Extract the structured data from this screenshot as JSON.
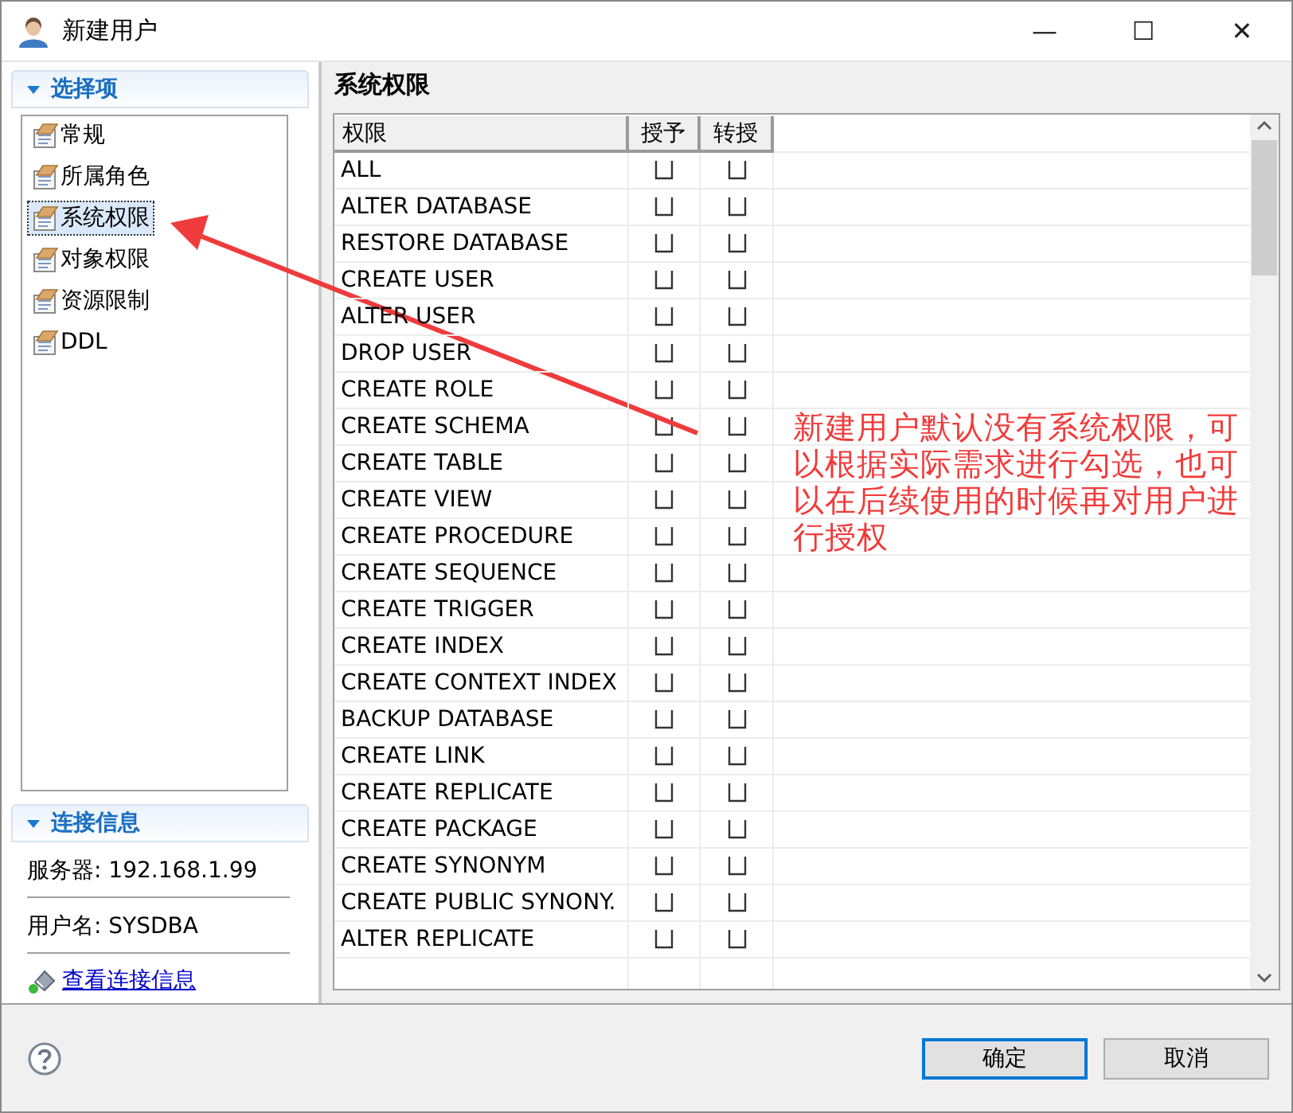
{
  "window": {
    "title": "新建用户",
    "controls": [
      "—",
      "☐",
      "✕"
    ]
  },
  "sidebar": {
    "sections": [
      {
        "title": "选择项",
        "expanded": true
      }
    ],
    "items": [
      {
        "label": "常规",
        "selected": false
      },
      {
        "label": "所属角色",
        "selected": false
      },
      {
        "label": "系统权限",
        "selected": true
      },
      {
        "label": "对象权限",
        "selected": false
      },
      {
        "label": "资源限制",
        "selected": false
      },
      {
        "label": "DDL",
        "selected": false
      }
    ]
  },
  "connection": {
    "title": "连接信息",
    "expanded": true,
    "server": "服务器: 192.168.1.99",
    "user": "用户名: SYSDBA",
    "link": "查看连接信息"
  },
  "panel": {
    "title": "系统权限"
  },
  "table": {
    "columns": [
      "权限",
      "授予",
      "转授"
    ],
    "rows": [
      {
        "name": "ALL",
        "grant": false,
        "regrant": false
      },
      {
        "name": "ALTER DATABASE",
        "grant": false,
        "regrant": false
      },
      {
        "name": "RESTORE DATABASE",
        "grant": false,
        "regrant": false
      },
      {
        "name": "CREATE USER",
        "grant": false,
        "regrant": false
      },
      {
        "name": "ALTER USER",
        "grant": false,
        "regrant": false
      },
      {
        "name": "DROP USER",
        "grant": false,
        "regrant": false
      },
      {
        "name": "CREATE ROLE",
        "grant": false,
        "regrant": false
      },
      {
        "name": "CREATE SCHEMA",
        "grant": false,
        "regrant": false
      },
      {
        "name": "CREATE TABLE",
        "grant": false,
        "regrant": false
      },
      {
        "name": "CREATE VIEW",
        "grant": false,
        "regrant": false
      },
      {
        "name": "CREATE PROCEDURE",
        "grant": false,
        "regrant": false
      },
      {
        "name": "CREATE SEQUENCE",
        "grant": false,
        "regrant": false
      },
      {
        "name": "CREATE TRIGGER",
        "grant": false,
        "regrant": false
      },
      {
        "name": "CREATE INDEX",
        "grant": false,
        "regrant": false
      },
      {
        "name": "CREATE CONTEXT INDEX",
        "grant": false,
        "regrant": false
      },
      {
        "name": "BACKUP DATABASE",
        "grant": false,
        "regrant": false
      },
      {
        "name": "CREATE LINK",
        "grant": false,
        "regrant": false
      },
      {
        "name": "CREATE REPLICATE",
        "grant": false,
        "regrant": false
      },
      {
        "name": "CREATE PACKAGE",
        "grant": false,
        "regrant": false
      },
      {
        "name": "CREATE SYNONYM",
        "grant": false,
        "regrant": false
      },
      {
        "name": "CREATE PUBLIC SYNONY.",
        "grant": false,
        "regrant": false
      },
      {
        "name": "ALTER REPLICATE",
        "grant": false,
        "regrant": false
      }
    ]
  },
  "annotation": {
    "text": "新建用户默认没有系统权限，可以根据实际需求进行勾选，也可以在后续使用的时候再对用户进行授权"
  },
  "footer": {
    "buttons": [
      {
        "label": "确定",
        "default": true
      },
      {
        "label": "取消",
        "default": false
      }
    ]
  }
}
